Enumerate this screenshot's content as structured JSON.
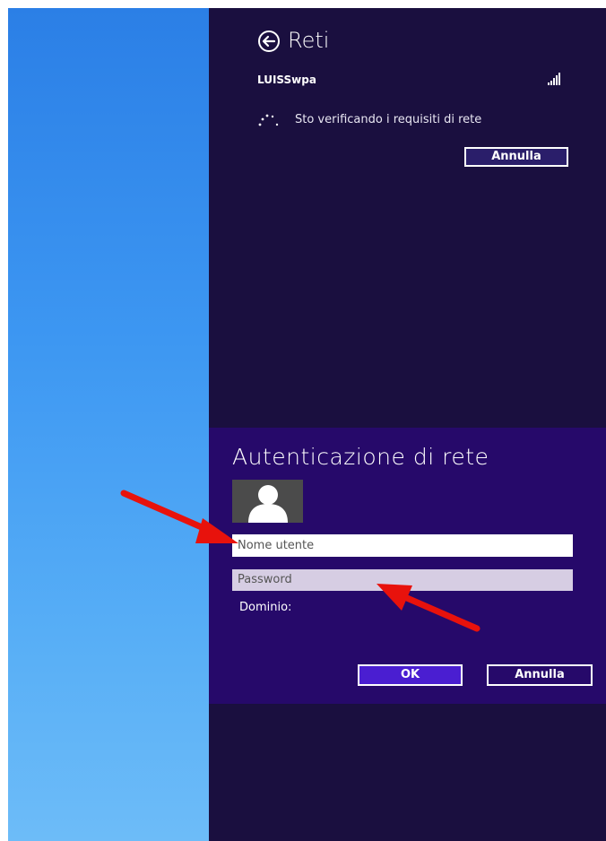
{
  "pane": {
    "title": "Reti",
    "network_name": "LUISSwpa",
    "status_text": "Sto verificando i requisiti di rete",
    "cancel_label": "Annulla"
  },
  "auth_dialog": {
    "title": "Autenticazione di rete",
    "username_placeholder": "Nome utente",
    "password_placeholder": "Password",
    "domain_label": "Dominio:",
    "ok_label": "OK",
    "cancel_label": "Annulla"
  },
  "icons": {
    "back": "back-arrow-circle-icon",
    "signal": "wifi-signal-bars-icon",
    "spinner": "loading-spinner-icon",
    "avatar": "user-silhouette-icon",
    "annotation": "red-arrow-icon"
  },
  "colors": {
    "charm_pane": "#1a0f3f",
    "dialog": "#26096a",
    "ok_button": "#4a1ed1",
    "annotation_arrow": "#e8120c"
  }
}
